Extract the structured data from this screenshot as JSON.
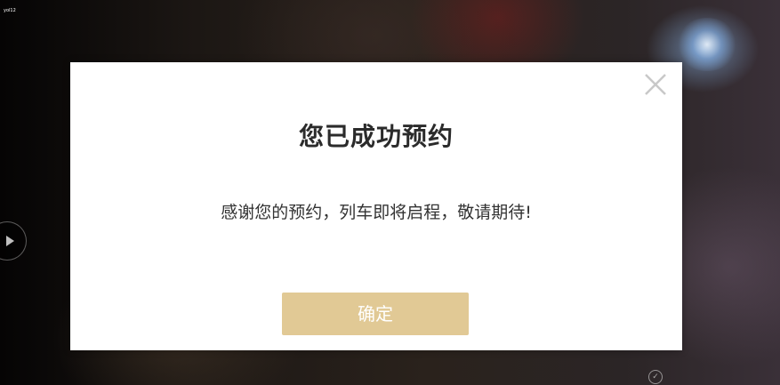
{
  "background": {
    "corner_label": "yol12"
  },
  "modal": {
    "title": "您已成功预约",
    "message": "感谢您的预约，列车即将启程，敬请期待!",
    "confirm_label": "确定",
    "close_icon": "close-icon"
  },
  "colors": {
    "confirm_button": "#e1c995",
    "close_icon": "#c8c8c8",
    "title": "#2b2b2b"
  }
}
